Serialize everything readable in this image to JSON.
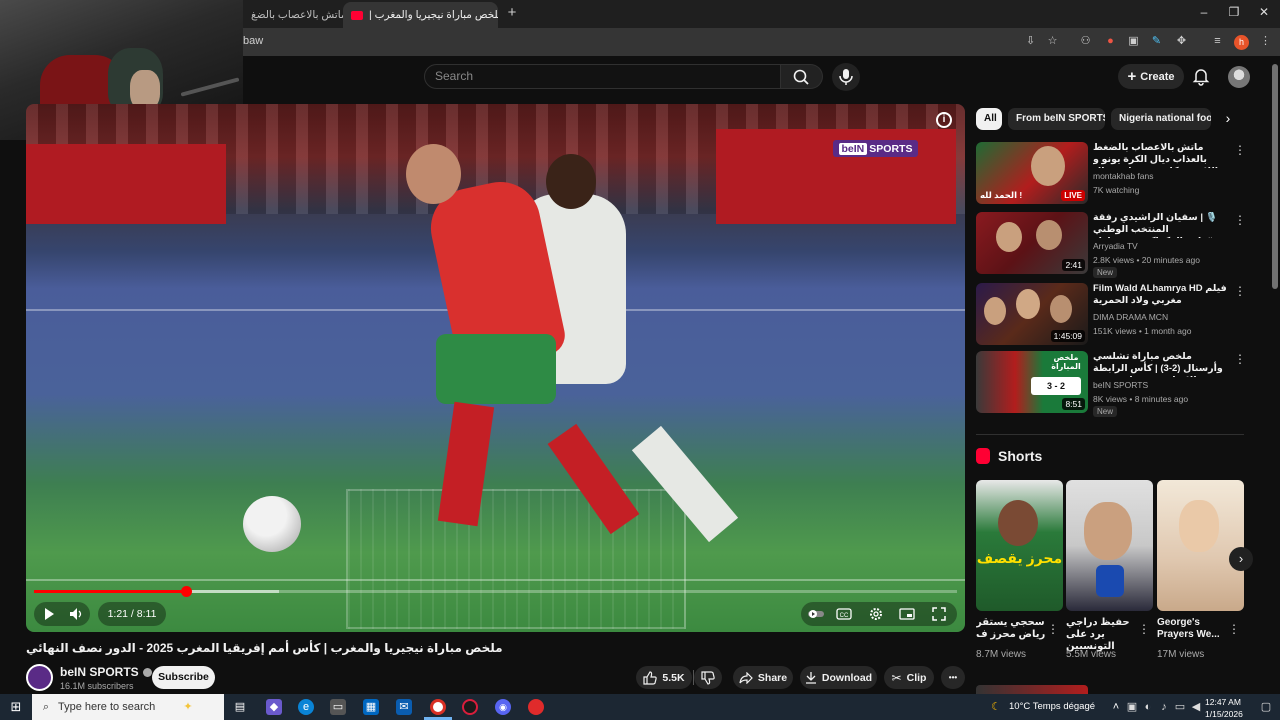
{
  "browser": {
    "tabs": [
      {
        "title": "ماتش بالاعصاب بالضغ",
        "active": false
      },
      {
        "title": "ملخص مباراة نيجيريا والمغرب |",
        "active": true
      }
    ],
    "new_tab": "+",
    "url_fragment": "baw",
    "profile_initial": "h"
  },
  "masthead": {
    "search_placeholder": "Search",
    "create_label": "Create"
  },
  "player": {
    "time_display": "1:21 / 8:11",
    "progress_played_fraction": 0.165,
    "channel_bug": {
      "part1": "beIN",
      "part2": "SPORTS"
    }
  },
  "video": {
    "title": "ملخص مباراة نيجيريا والمغرب | كأس أمم إفريقيا المغرب 2025 - الدور نصف النهائي",
    "channel": "beIN SPORTS",
    "subscribers": "16.1M subscribers",
    "subscribe_label": "Subscribe",
    "likes": "5.5K",
    "share_label": "Share",
    "download_label": "Download",
    "clip_label": "Clip",
    "more_label": "•••"
  },
  "chips": [
    {
      "label": "All",
      "active": true
    },
    {
      "label": "From beIN SPORTS",
      "active": false
    },
    {
      "label": "Nigeria national footb",
      "active": false
    }
  ],
  "recommendations": [
    {
      "title": "ماتش بالاعصاب بالضغط بالعذاب ديال الكرة يونو و اللاعبين كانو ف هدا و رجال",
      "channel": "montakhab fans",
      "meta": "7K watching",
      "badge": "LIVE",
      "is_new": false
    },
    {
      "title": "🎙️ | سفيان الراشيدي رفقة المنتخب الوطني #وليد_الركراكي بعد مباراة نيجيريا",
      "channel": "Arryadia TV",
      "meta": "2.8K views • 20 minutes ago",
      "badge": "2:41",
      "is_new": true,
      "new_label": "New"
    },
    {
      "title": "Film Wald ALhamrya HD فيلم مغربي ولاد الحمرية",
      "channel": "DIMA DRAMA MCN",
      "meta": "151K views • 1 month ago",
      "badge": "1:45:09",
      "is_new": false
    },
    {
      "title": "ملخص مباراة تشلسي وأرسنال (2-3) | كأس الرابطة الإنجليزية - ذهاب نصف النهائي",
      "channel": "beIN SPORTS",
      "meta": "8K views • 8 minutes ago",
      "badge": "8:51",
      "is_new": true,
      "new_label": "New"
    }
  ],
  "thumb_texts": {
    "rec1_caption": "الحمد لله !",
    "rec4_caption": "ملخص المباراة",
    "rec4_score": "3 - 2"
  },
  "shorts": {
    "heading": "Shorts",
    "items": [
      {
        "title": "سحجي يستقر رياض محرز ف",
        "views": "8.7M views",
        "thumb_caption": "محرز يقصف"
      },
      {
        "title": "حفيظ دراجي يرد على التونسيين",
        "views": "5.5M views"
      },
      {
        "title": "George's Prayers We...",
        "views": "17M views"
      }
    ]
  },
  "taskbar": {
    "search_placeholder": "Type here to search",
    "weather": "10°C  Temps dégagé",
    "time": "12:47 AM",
    "date": "1/15/2026"
  },
  "colors": {
    "accent": "#ff0000",
    "background": "#0f0f0f",
    "chip_bg": "#272727",
    "bein_purple": "#5a2b86"
  }
}
